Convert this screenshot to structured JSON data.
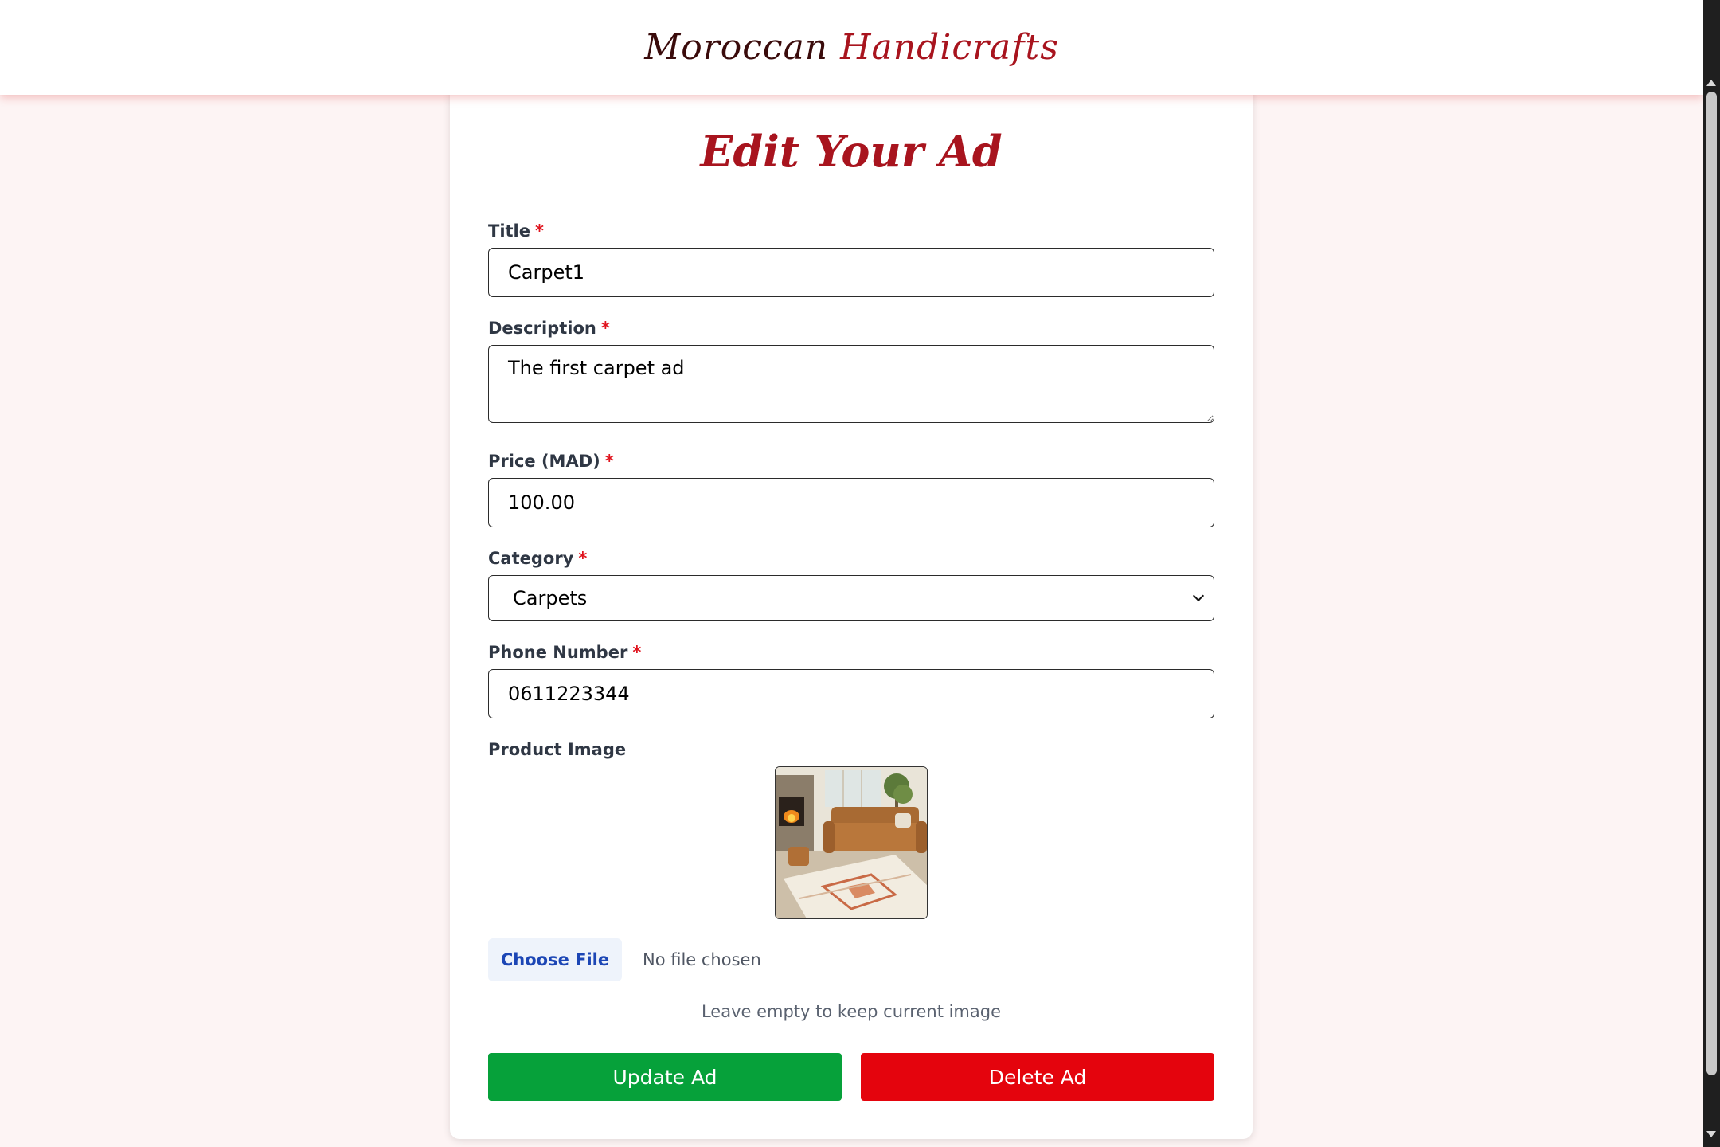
{
  "header": {
    "brand_part1": "Moroccan ",
    "brand_part2": "Handicrafts"
  },
  "form": {
    "heading": "Edit Your Ad",
    "title_label": "Title",
    "title_value": "Carpet1",
    "description_label": "Description",
    "description_value": "The first carpet ad",
    "price_label": "Price (MAD)",
    "price_value": "100.00",
    "category_label": "Category",
    "category_value": "Carpets",
    "phone_label": "Phone Number",
    "phone_value": "0611223344",
    "image_label": "Product Image",
    "required_mark": "*",
    "choose_file_label": "Choose File",
    "no_file_text": "No file chosen",
    "hint_text": "Leave empty to keep current image",
    "update_label": "Update Ad",
    "delete_label": "Delete Ad"
  },
  "colors": {
    "brand_red": "#a8141e",
    "update_green": "#06a13a",
    "delete_red": "#e4040d",
    "page_bg": "#fdf4f4"
  }
}
